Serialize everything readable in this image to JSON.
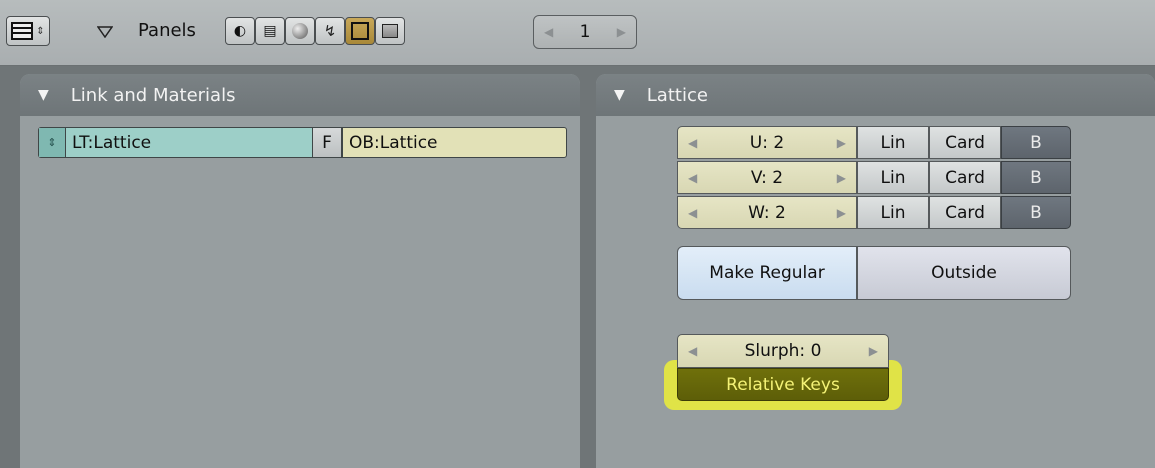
{
  "header": {
    "panels_label": "Panels",
    "frame_number": "1",
    "context_buttons": [
      {
        "icon": "logic-icon"
      },
      {
        "icon": "script-icon"
      },
      {
        "icon": "shading-icon"
      },
      {
        "icon": "object-icon"
      },
      {
        "icon": "editing-icon",
        "active": true
      },
      {
        "icon": "scene-icon"
      }
    ]
  },
  "link_materials": {
    "title": "Link and Materials",
    "lt_name": "LT:Lattice",
    "f_label": "F",
    "ob_name": "OB:Lattice"
  },
  "lattice": {
    "title": "Lattice",
    "rows": [
      {
        "field": "U: 2",
        "lin": "Lin",
        "card": "Card",
        "b": "B"
      },
      {
        "field": "V: 2",
        "lin": "Lin",
        "card": "Card",
        "b": "B"
      },
      {
        "field": "W: 2",
        "lin": "Lin",
        "card": "Card",
        "b": "B"
      }
    ],
    "make_regular": "Make Regular",
    "outside": "Outside",
    "slurph": "Slurph: 0",
    "relative_keys": "Relative Keys"
  },
  "colors": {
    "highlight": "#ecee37",
    "relative_keys_bg": "#6f700b"
  }
}
